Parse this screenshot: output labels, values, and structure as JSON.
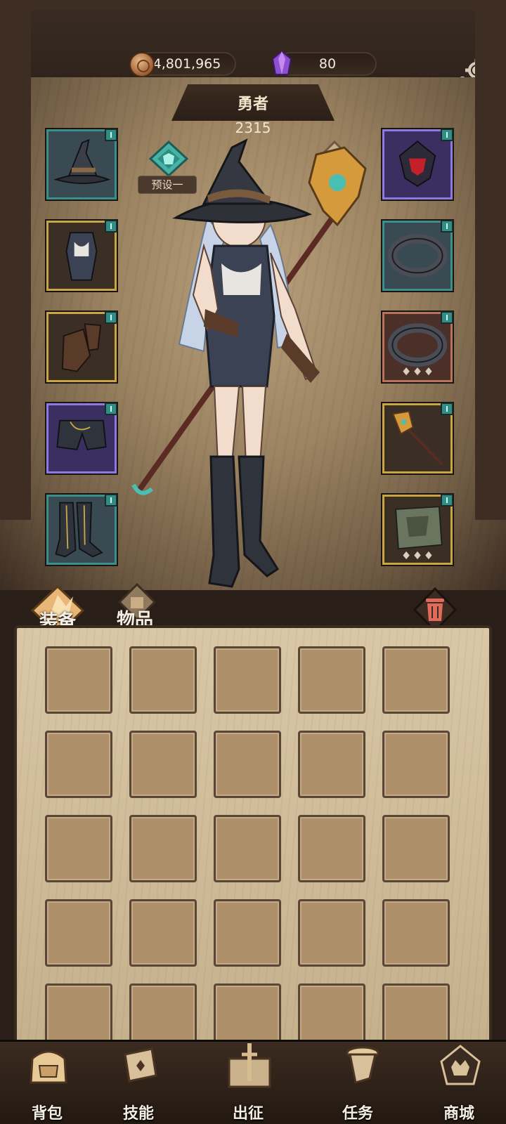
{
  "currency": {
    "coins": "4,801,965",
    "gems": "80"
  },
  "hero": {
    "title": "勇者",
    "power": "2315",
    "preset_label": "预设一"
  },
  "equipment": {
    "left": [
      {
        "name": "hat",
        "quality": "teal"
      },
      {
        "name": "armor",
        "quality": "gold"
      },
      {
        "name": "gloves",
        "quality": "gold"
      },
      {
        "name": "pants",
        "quality": "purple"
      },
      {
        "name": "boots",
        "quality": "teal"
      }
    ],
    "right": [
      {
        "name": "amulet",
        "quality": "purple"
      },
      {
        "name": "ring",
        "quality": "teal"
      },
      {
        "name": "ring",
        "quality": "red"
      },
      {
        "name": "staff",
        "quality": "gold"
      },
      {
        "name": "offhand",
        "quality": "gold"
      }
    ]
  },
  "bag": {
    "tabs": [
      {
        "label": "装备",
        "active": true
      },
      {
        "label": "物品",
        "active": false
      }
    ]
  },
  "nav": {
    "items": [
      {
        "label": "背包",
        "icon": "backpack-icon"
      },
      {
        "label": "技能",
        "icon": "skill-book-icon"
      },
      {
        "label": "出征",
        "icon": "map-sword-icon"
      },
      {
        "label": "任务",
        "icon": "scroll-icon"
      },
      {
        "label": "商城",
        "icon": "shop-crown-icon"
      }
    ]
  },
  "colors": {
    "teal_quality": "#3c8f8a",
    "gold_quality": "#c9a645",
    "purple_quality": "#8e79e0",
    "red_quality": "#b7735c",
    "panel_bg": "#cdb995"
  }
}
